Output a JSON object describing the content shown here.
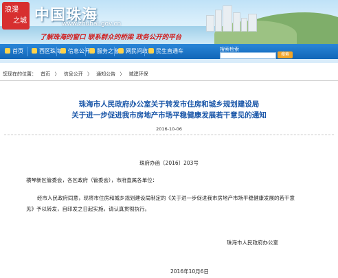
{
  "header": {
    "seal_line1": "浪漫",
    "seal_line2": "之城",
    "logo": "中国珠海",
    "url": "www.zhuhai.gov.cn",
    "slogan": "了解珠海的窗口 联系群众的桥梁 政务公开的平台"
  },
  "nav": {
    "items": [
      {
        "label": "首页"
      },
      {
        "label": "西区珠海"
      },
      {
        "label": "信息公开"
      },
      {
        "label": "服务之窗"
      },
      {
        "label": "网民问政"
      },
      {
        "label": "民生直通车"
      }
    ],
    "search_label": "搜索检索",
    "search_button": "搜索"
  },
  "breadcrumb": {
    "prefix": "您现在的位置：",
    "items": [
      "首页",
      "信息公开",
      "通知公告",
      "城建环保"
    ],
    "separator": "〉"
  },
  "document": {
    "title_line1": "珠海市人民政府办公室关于转发市住房和城乡规划建设局",
    "title_line2": "关于进一步促进我市房地产市场平稳健康发展若干意见的通知",
    "date": "2016-10-06",
    "number": "珠府办函〔2016〕203号",
    "salutation": "横琴新区管委会，各区政府（管委会），市府直属各单位：",
    "body_line1": "经市人民政府同意，现将市住房和城乡规划建设局制定的《关于进一步促进我市房地产市场平稳健康发展的若干意",
    "body_line2": "见》予以转发，自印发之日起实施，请认真贯彻执行。",
    "signature": "珠海市人民政府办公室",
    "sign_date": "2016年10月6日"
  },
  "colors": {
    "nav": "#1a74c8",
    "title": "#1a56a8",
    "slogan": "#d11d1d"
  }
}
